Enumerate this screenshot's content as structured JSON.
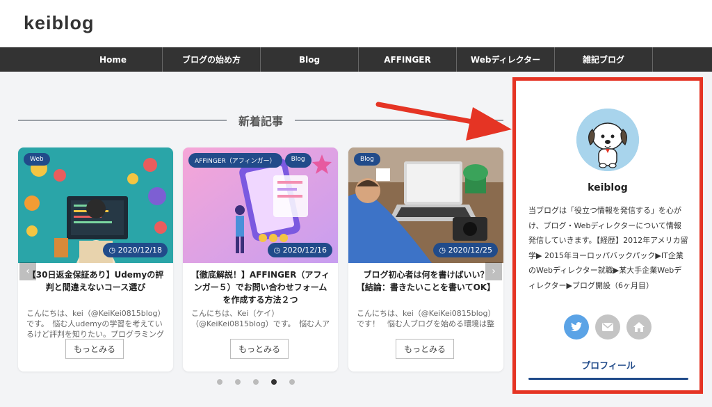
{
  "site": {
    "logo": "keiblog"
  },
  "nav": {
    "items": [
      "Home",
      "ブログの始め方",
      "Blog",
      "AFFINGER",
      "Webディレクター",
      "雑記ブログ"
    ]
  },
  "section": {
    "heading": "新着記事"
  },
  "slider": {
    "prev_icon": "‹",
    "next_icon": "›"
  },
  "posts": [
    {
      "badges": [
        "Web"
      ],
      "date": "2020/12/18",
      "title": "【30日返金保証あり】Udemyの評判と間違えないコース選び",
      "excerpt": "こんにちは、kei（@KeiKei0815blog）です。　悩む人udemyの学習を考えているけど評判を知りたい。プログラミング",
      "more": "もっとみる"
    },
    {
      "badges": [
        "AFFINGER（アフィンガー）",
        "Blog"
      ],
      "date": "2020/12/16",
      "title": "【徹底解説！】AFFINGER（アフィンガー５）でお問い合わせフォームを作成する方法２つ",
      "excerpt": "こんにちは、Kei（ケイ）（@KeiKei0815blog）です。　悩む人ア",
      "more": "もっとみる"
    },
    {
      "badges": [
        "Blog"
      ],
      "date": "2020/12/25",
      "title": "ブログ初心者は何を書けばいい？【結論：書きたいことを書いてOK】",
      "excerpt": "こんにちは、kei（@KeiKei0815blog）です！　悩む人ブログを始める環境は整",
      "more": "もっとみる"
    }
  ],
  "pagination": {
    "count": 5,
    "active_index": 3
  },
  "profile": {
    "name": "keiblog",
    "description": "当ブログは「役立つ情報を発信する」を心がけ、ブログ・Webディレクターについて情報発信していきます。【経歴】2012年アメリカ留学▶ 2015年ヨーロッパバックパック▶IT企業のWebディレクター就職▶某大手企業Webディレクター▶ブログ開設（6ヶ月目）",
    "link": "プロフィール",
    "social_icons": [
      "twitter-icon",
      "mail-icon",
      "home-icon"
    ]
  },
  "colors": {
    "accent": "#214b8a",
    "highlight": "#e53424",
    "nav_bg": "#333333",
    "twitter": "#5ba3e6",
    "social_gray": "#c4c4c4"
  }
}
